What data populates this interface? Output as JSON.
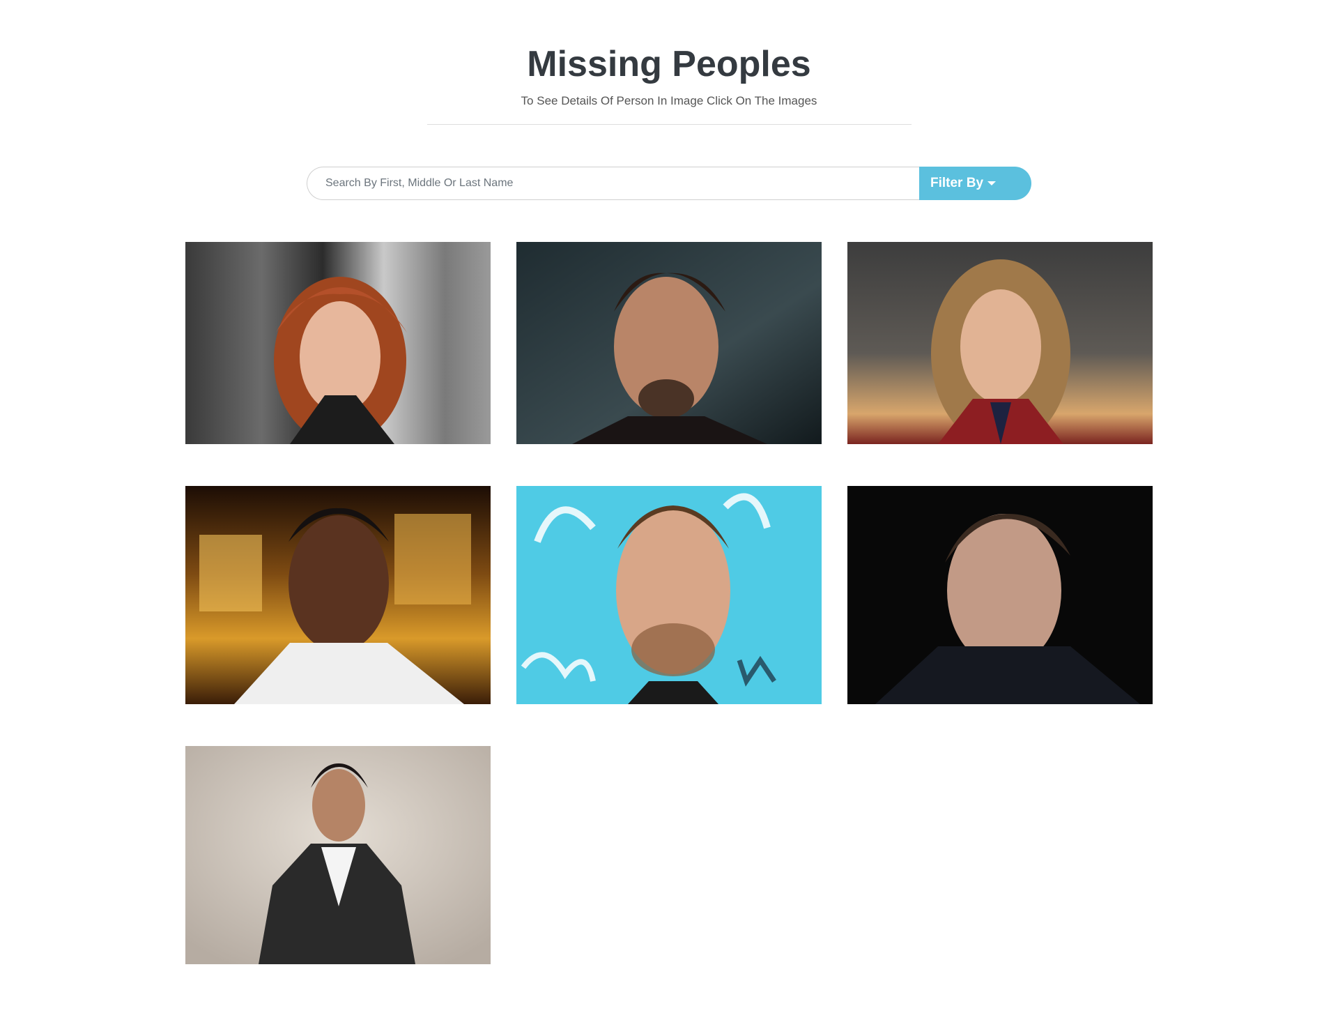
{
  "header": {
    "title": "Missing Peoples",
    "subtitle": "To See Details Of Person In Image Click On The Images"
  },
  "search": {
    "placeholder": "Search By First, Middle Or Last Name",
    "value": "",
    "filter_label": "Filter By"
  },
  "colors": {
    "title": "#343a40",
    "accent": "#5bc0de"
  },
  "gallery": {
    "photos": [
      {
        "description": "photo-red-haired-woman"
      },
      {
        "description": "photo-man-goatee-dark-background"
      },
      {
        "description": "photo-blonde-woman-red-suit"
      },
      {
        "description": "photo-man-white-tshirt-city-lights"
      },
      {
        "description": "photo-man-beard-blue-background"
      },
      {
        "description": "photo-man-dark-jacket"
      },
      {
        "description": "photo-man-black-suit-beige-background"
      }
    ]
  }
}
